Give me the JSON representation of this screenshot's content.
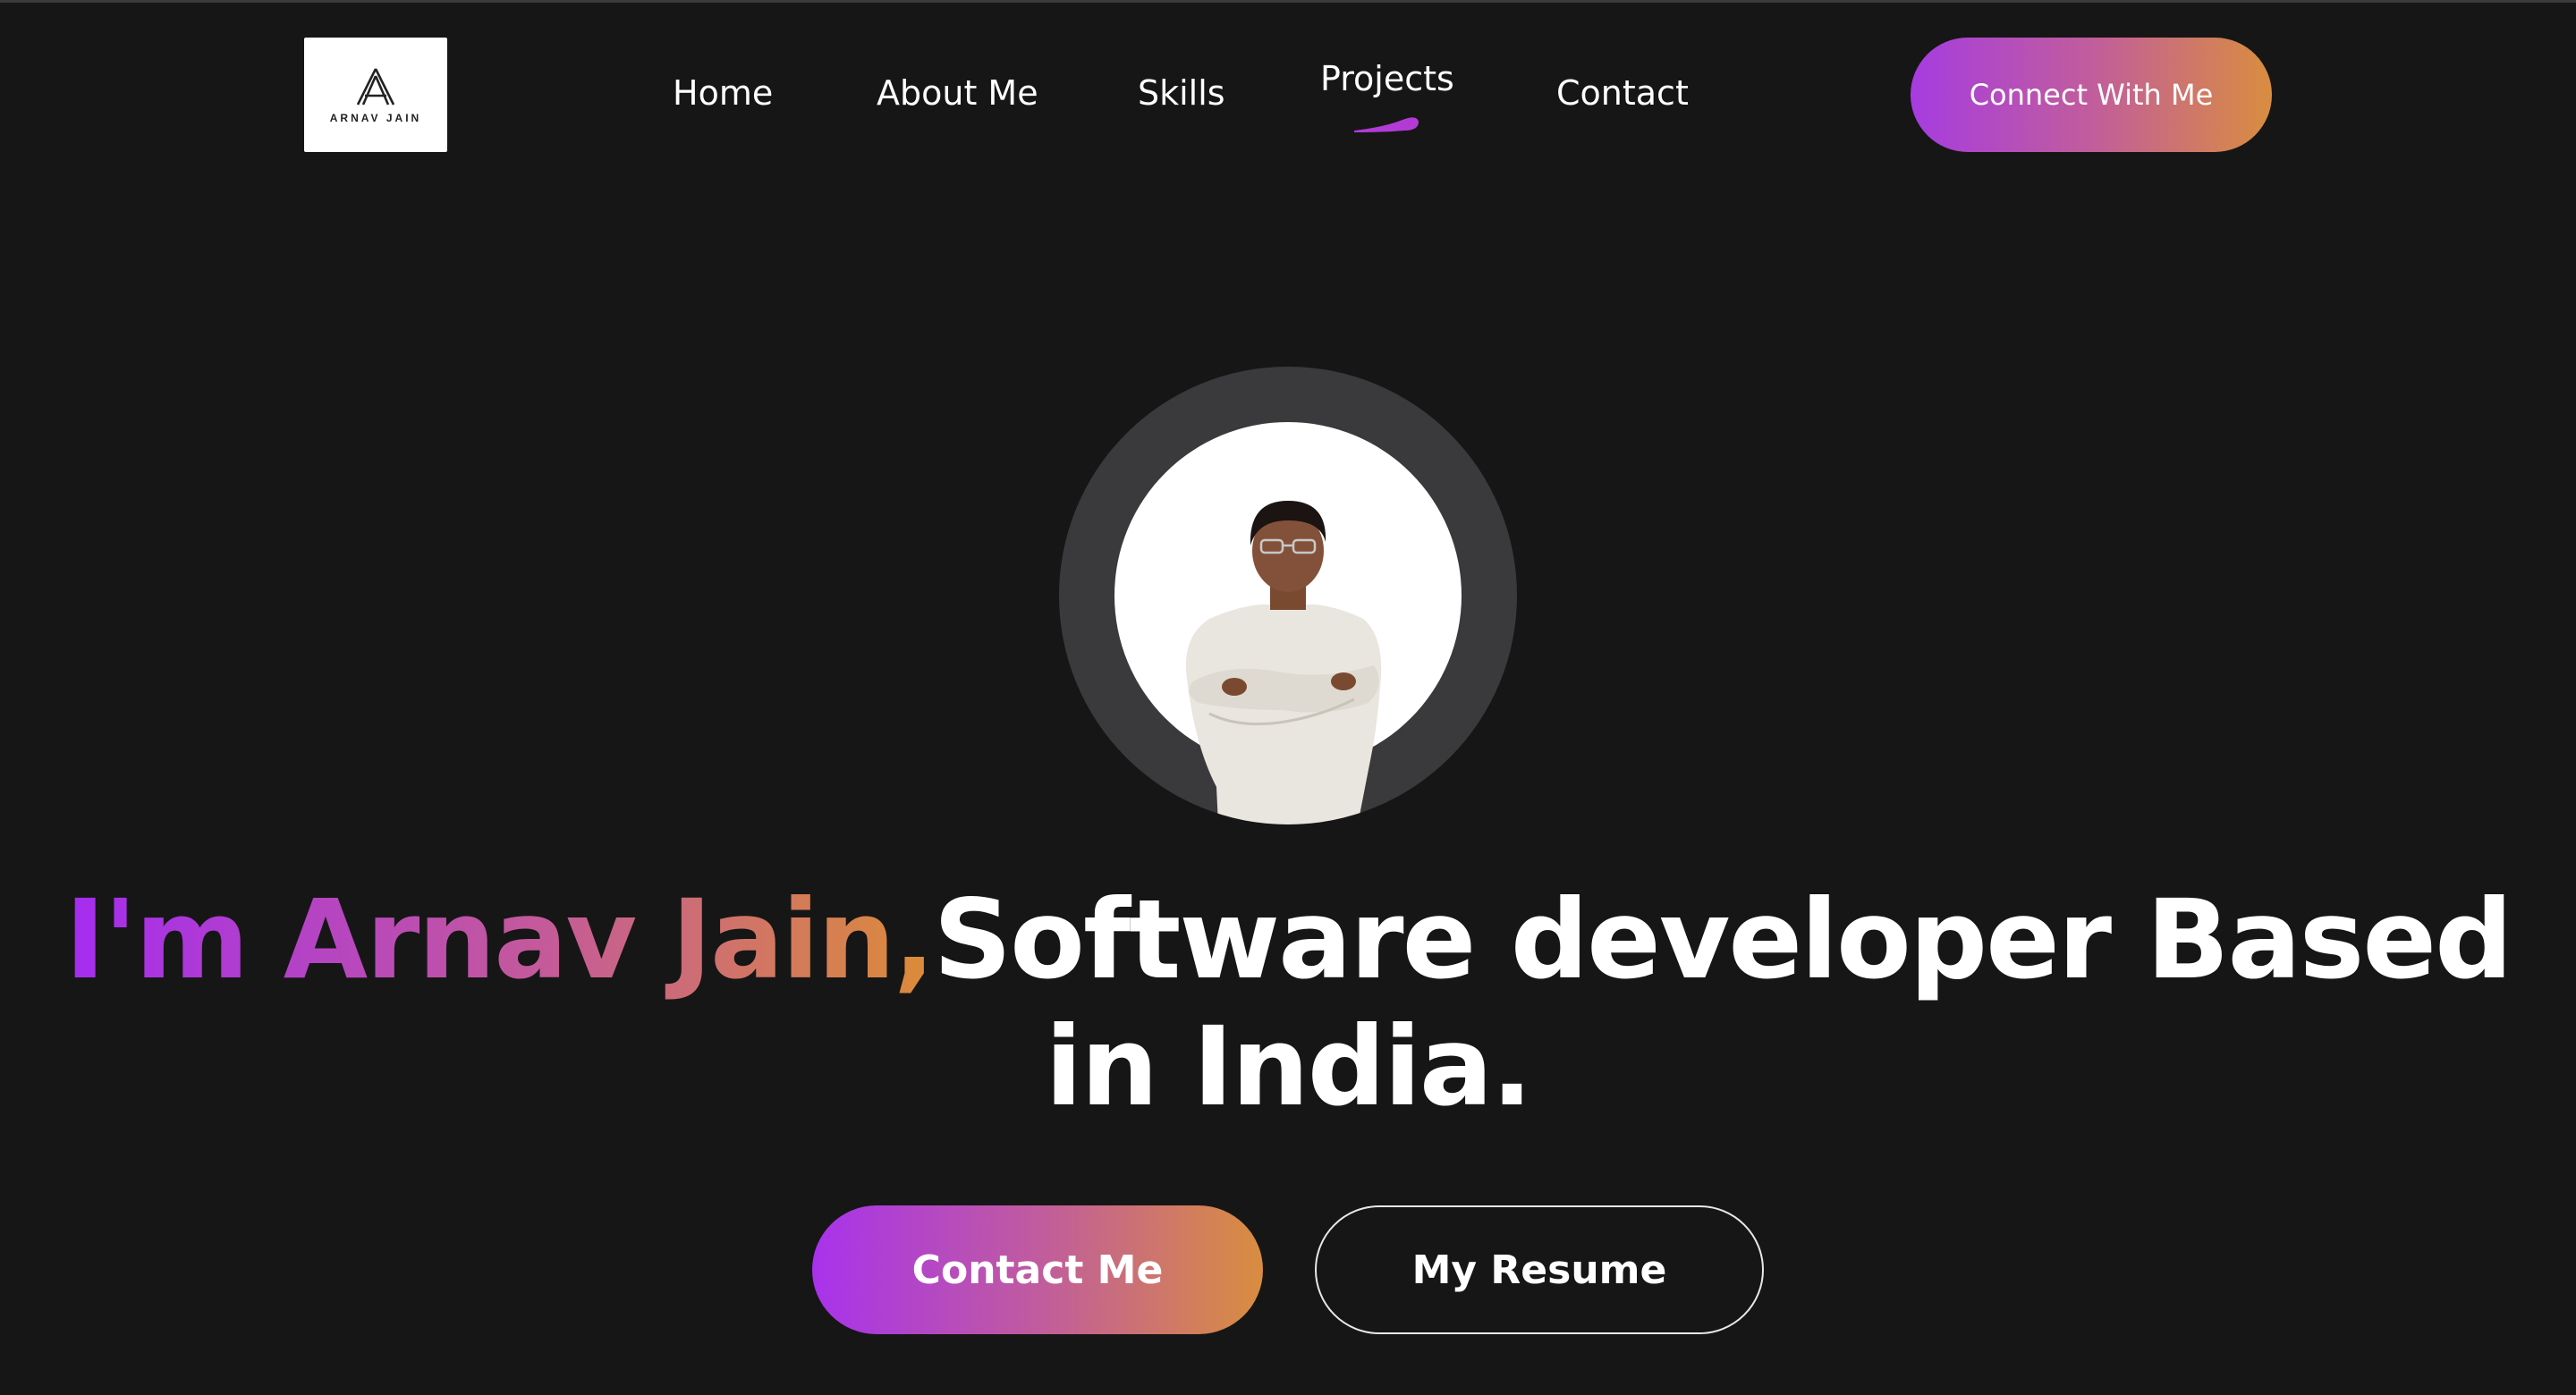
{
  "nav": {
    "logo_text": "ARNAV JAIN",
    "items": [
      {
        "label": "Home"
      },
      {
        "label": "About Me"
      },
      {
        "label": "Skills"
      },
      {
        "label": "Projects"
      },
      {
        "label": "Contact"
      }
    ],
    "active_item": "Projects",
    "cta_label": "Connect With Me"
  },
  "hero": {
    "avatar_icon": "person-portrait-icon",
    "headline_gradient": "I'm Arnav Jain,",
    "headline_rest": "Software developer Based in India.",
    "primary_button": "Contact Me",
    "secondary_button": "My Resume"
  },
  "colors": {
    "background": "#161616",
    "gradient_start": "#a52cf0",
    "gradient_end": "#dc8c38",
    "avatar_ring": "#3a3a3c"
  }
}
